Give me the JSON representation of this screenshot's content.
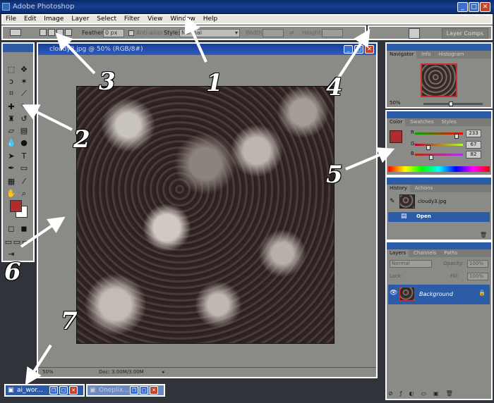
{
  "titlebar": {
    "title": "Adobe Photoshop"
  },
  "menubar": {
    "items": [
      "File",
      "Edit",
      "Image",
      "Layer",
      "Select",
      "Filter",
      "View",
      "Window",
      "Help"
    ]
  },
  "options": {
    "feather_label": "Feather:",
    "feather_value": "0 px",
    "antialias_label": "Anti-alias",
    "style_label": "Style:",
    "style_value": "Normal",
    "width_label": "Width:",
    "height_label": "Height:"
  },
  "palette_well": {
    "tab": "Layer Comps"
  },
  "document": {
    "title": "cloudy3.jpg @ 50% (RGB/8#)",
    "zoom": "50%",
    "doc_info": "Doc: 3.00M/3.00M"
  },
  "navigator": {
    "tabs": [
      "Navigator",
      "Info",
      "Histogram"
    ],
    "zoom": "50%"
  },
  "color": {
    "tabs": [
      "Color",
      "Swatches",
      "Styles"
    ],
    "channels": [
      {
        "label": "R",
        "value": "233",
        "level": 0.91
      },
      {
        "label": "G",
        "value": "67",
        "level": 0.26
      },
      {
        "label": "B",
        "value": "82",
        "level": 0.32
      }
    ],
    "foreground": "#b32c2c"
  },
  "history": {
    "tabs": [
      "History",
      "Actions"
    ],
    "snapshot": "cloudy3.jpg",
    "step": "Open"
  },
  "layers": {
    "tabs": [
      "Layers",
      "Channels",
      "Paths"
    ],
    "blend_mode": "Normal",
    "opacity_label": "Opacity:",
    "opacity_value": "100%",
    "lock_label": "Lock:",
    "fill_label": "Fill:",
    "fill_value": "100%",
    "layer_name": "Background"
  },
  "taskbar": [
    {
      "label": "ai_wor..."
    },
    {
      "label": "Oneplix..."
    }
  ],
  "annotations": [
    "1",
    "2",
    "3",
    "4",
    "5",
    "6",
    "7"
  ]
}
